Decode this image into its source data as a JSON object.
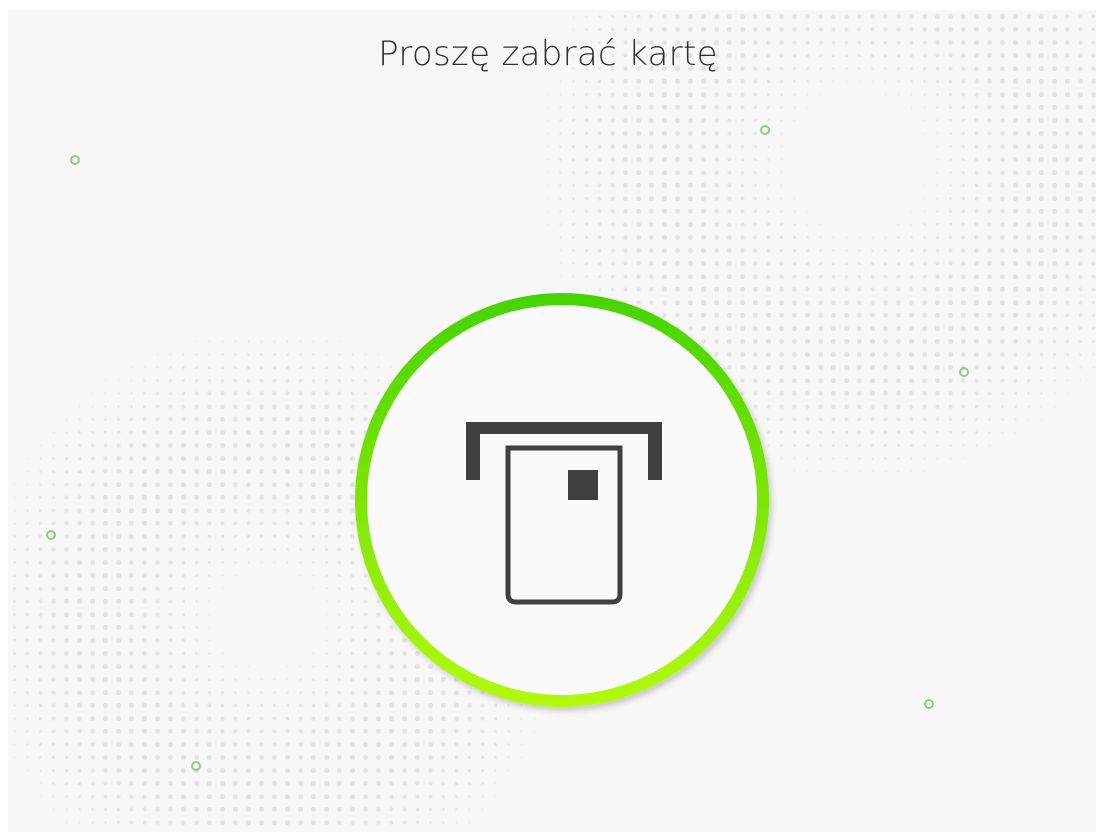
{
  "screen": {
    "title": "Proszę zabrać kartę"
  },
  "status_ring": {
    "gradient_top": "#44d400",
    "gradient_bottom": "#b4f90c",
    "fill": "#fafafa",
    "icon": "card-eject-icon",
    "icon_color": "#404040"
  },
  "decor": {
    "bubble_color": "#8ccf7d",
    "dot_color": "#dddddd",
    "panel_color": "#f7f7f7"
  }
}
